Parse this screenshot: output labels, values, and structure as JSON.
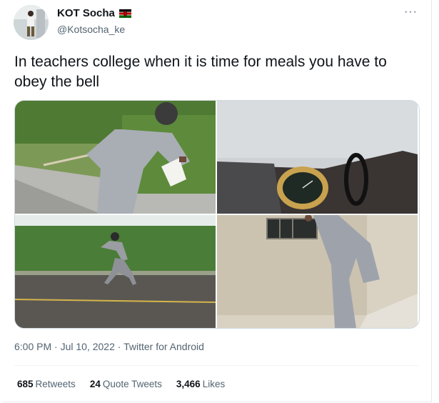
{
  "author": {
    "display_name": "KOT Socha",
    "handle": "@Kotsocha_ke",
    "flag_icon": "kenya-flag-icon"
  },
  "more_icon": "···",
  "tweet": {
    "text": "In teachers college when it is time for meals you have to obey the bell"
  },
  "meta": {
    "time": "6:00 PM",
    "sep1": " · ",
    "date": "Jul 10, 2022",
    "sep2": " · ",
    "source": "Twitter for Android"
  },
  "stats": [
    {
      "count": "685",
      "label": "Retweets"
    },
    {
      "count": "24",
      "label": "Quote Tweets"
    },
    {
      "count": "3,466",
      "label": "Likes"
    }
  ],
  "colors": {
    "text": "#0f1419",
    "secondary": "#536471",
    "border": "#cfd9de"
  }
}
